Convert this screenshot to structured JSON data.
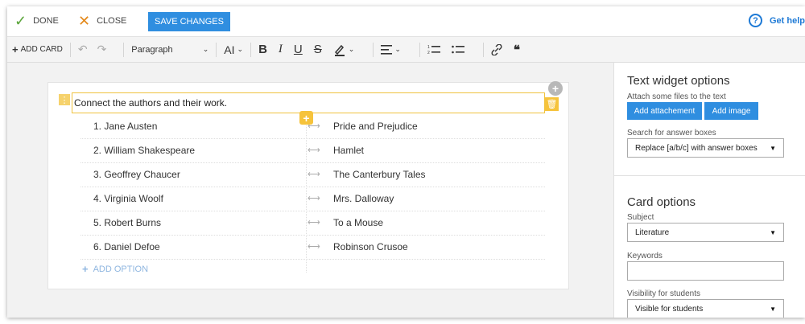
{
  "topbar": {
    "done_label": "DONE",
    "close_label": "CLOSE",
    "save_label": "SAVE CHANGES",
    "help_label": "Get help"
  },
  "toolbar": {
    "add_card_label": "ADD CARD",
    "paragraph_label": "Paragraph",
    "font_size_label": "AI"
  },
  "card": {
    "prompt": "Connect the authors and their work.",
    "rows": [
      {
        "left": "1. Jane Austen",
        "right": "Pride and Prejudice"
      },
      {
        "left": "2. William Shakespeare",
        "right": "Hamlet"
      },
      {
        "left": "3. Geoffrey Chaucer",
        "right": "The Canterbury Tales"
      },
      {
        "left": "4. Virginia Woolf",
        "right": "Mrs. Dalloway"
      },
      {
        "left": "5. Robert Burns",
        "right": "To a Mouse"
      },
      {
        "left": "6. Daniel Defoe",
        "right": "Robinson Crusoe"
      }
    ],
    "add_option_label": "ADD OPTION"
  },
  "sidebar": {
    "text_widget_title": "Text widget options",
    "attach_label": "Attach some files to the text",
    "add_attachment_label": "Add attachement",
    "add_image_label": "Add image",
    "search_label": "Search for answer boxes",
    "search_value": "Replace [a/b/c] with answer boxes",
    "card_options_title": "Card options",
    "subject_label": "Subject",
    "subject_value": "Literature",
    "keywords_label": "Keywords",
    "keywords_value": "",
    "visibility_label": "Visibility for students",
    "visibility_value": "Visible for students"
  },
  "colors": {
    "accent": "#2f8ee0",
    "done_green": "#5aa53a",
    "close_orange": "#e3891b",
    "highlight_yellow": "#f6c33b"
  }
}
